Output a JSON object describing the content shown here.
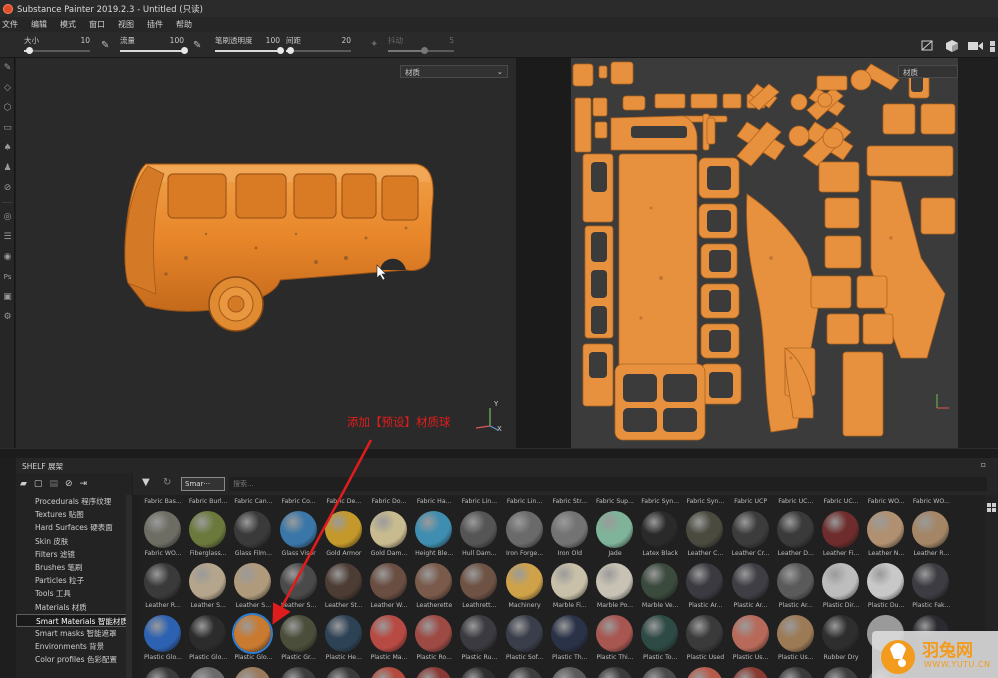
{
  "window": {
    "title": "Substance Painter 2019.2.3 - Untitled (只读)"
  },
  "menu": [
    "文件",
    "编辑",
    "模式",
    "窗口",
    "视图",
    "插件",
    "帮助"
  ],
  "tool_options": {
    "sliders": [
      {
        "label": "大小",
        "value": "10",
        "level": 0.08
      },
      {
        "label": "流量",
        "value": "100",
        "level": 1.0
      },
      {
        "label": "笔刷透明度",
        "value": "100",
        "level": 1.0
      },
      {
        "label": "间距",
        "value": "20",
        "level": 0.06
      },
      {
        "label": "抖动",
        "value": "5",
        "level": 0.55
      }
    ]
  },
  "viewport3d": {
    "channel_dropdown": "材质"
  },
  "viewport2d": {
    "channel_dropdown": "材质"
  },
  "annotation": {
    "text": "添加【预设】材质球"
  },
  "shelf": {
    "title": "SHELF 展架",
    "categories": [
      {
        "label": "Procedurals 程序纹理"
      },
      {
        "label": "Textures 贴图"
      },
      {
        "label": "Hard Surfaces 硬表面"
      },
      {
        "label": "Skin 皮肤"
      },
      {
        "label": "Filters 滤镜"
      },
      {
        "label": "Brushes 笔刷"
      },
      {
        "label": "Particles 粒子"
      },
      {
        "label": "Tools 工具"
      },
      {
        "label": "Materials 材质"
      },
      {
        "label": "Smart Materials 智能材质"
      },
      {
        "label": "Smart masks 智能遮罩"
      },
      {
        "label": "Environments 背景"
      },
      {
        "label": "Color profiles 色彩配置"
      }
    ],
    "selected_category": 9,
    "filter_chip": "Smar···",
    "search_placeholder": "搜索...",
    "rows": [
      {
        "labels": [
          "Fabric Bas...",
          "Fabric Burl...",
          "Fabric Can...",
          "Fabric Co...",
          "Fabric De...",
          "Fabric Do...",
          "Fabric Ha...",
          "Fabric Lin...",
          "Fabric Lin...",
          "Fabric Str...",
          "Fabric Sup...",
          "Fabric Syn...",
          "Fabric Syn...",
          "Fabric UCP",
          "Fabric UC...",
          "Fabric UC...",
          "Fabric WO...",
          "Fabric WO..."
        ],
        "colors": [
          "#6d6d64",
          "#6b7a3c",
          "#3a3a3a",
          "#3a77a8",
          "#c4982a",
          "#c8bb8f",
          "#3f8db0",
          "#555555",
          "#6a6a6a",
          "#737373",
          "#7fb39a",
          "#2a2a2a",
          "#4a4a3e",
          "#3c3c3c",
          "#3a3a3a",
          "#6e2c2c",
          "#b09070",
          "#a48666"
        ]
      },
      {
        "labels": [
          "Fabric WO...",
          "Fiberglass...",
          "Glass Film...",
          "Glass Visor",
          "Gold Armor",
          "Gold Dam...",
          "Height Ble...",
          "Hull Dam...",
          "Iron Forge...",
          "Iron Old",
          "Jade",
          "Latex Black",
          "Leather C...",
          "Leather Cr...",
          "Leather D...",
          "Leather Fi...",
          "Leather N...",
          "Leather R..."
        ],
        "colors": [
          "#3a3a3a",
          "#b5a58c",
          "#b09a7c",
          "#4a4a4a",
          "#4d3c34",
          "#6a4e42",
          "#7a5a4a",
          "#6e5244",
          "#cfa24a",
          "#c8c0a8",
          "#c8c2b4",
          "#3a4a3c",
          "#3a3a40",
          "#3e3e44",
          "#5a5a5a",
          "#bdbdbd",
          "#c8c8c8",
          "#3c3c42"
        ]
      },
      {
        "labels": [
          "Leather R...",
          "Leather S...",
          "Leather S...",
          "Leather S...",
          "Leather St...",
          "Leather W...",
          "Leatherette",
          "Leathrett...",
          "Machinery",
          "Marble Fi...",
          "Marble Po...",
          "Marble Ve...",
          "Plastic Ar...",
          "Plastic Ar...",
          "Plastic Ar...",
          "Plastic Dir...",
          "Plastic Du...",
          "Plastic Fak..."
        ],
        "colors": [
          "#2d62b2",
          "#2c2c2c",
          "#c87a30",
          "#4a4e3a",
          "#2e4256",
          "#b84a44",
          "#9e4a44",
          "#3a3a40",
          "#3a3e4a",
          "#2a3248",
          "#a85650",
          "#2e4a44",
          "#3a3a3a",
          "#b86a5a",
          "#9c7a56",
          "#2e2e2e",
          "#9a9a9a",
          "#2a2a30"
        ]
      },
      {
        "labels": [
          "Plastic Glo...",
          "Plastic Glo...",
          "Plastic Glo...",
          "Plastic Gr...",
          "Plastic He...",
          "Plastic Ma...",
          "Plastic Ro...",
          "Plastic Ru...",
          "Plastic Sof...",
          "Plastic Th...",
          "Plastic Thi...",
          "Plastic To...",
          "Plastic Used",
          "Plastic Us...",
          "Plastic Us...",
          "Rubber Dry",
          "Ru..."
        ],
        "colors": [
          "#3a3a3a",
          "#6a6a6a",
          "#9a7a5a",
          "#3c3c3c",
          "#3a3a3a",
          "#b44a3c",
          "#8a3a34",
          "#2e2e2e",
          "#3e3e3e",
          "#5a5a5a",
          "#3a3a3a",
          "#4a4a4a",
          "#b85a4a",
          "#8a3a30",
          "#3a3a3a",
          "#3e3e3e",
          "#3a3a3a"
        ]
      }
    ],
    "selected_ball": {
      "row": 2,
      "col": 2
    }
  },
  "watermark": {
    "brand": "羽兔网",
    "url": "WWW.YUTU.CN"
  },
  "colors": {
    "bus_orange": "#e8862a",
    "uv_orange": "#e7913e",
    "annotation_red": "#e11c1c",
    "selection_blue": "#2d7fd6"
  }
}
